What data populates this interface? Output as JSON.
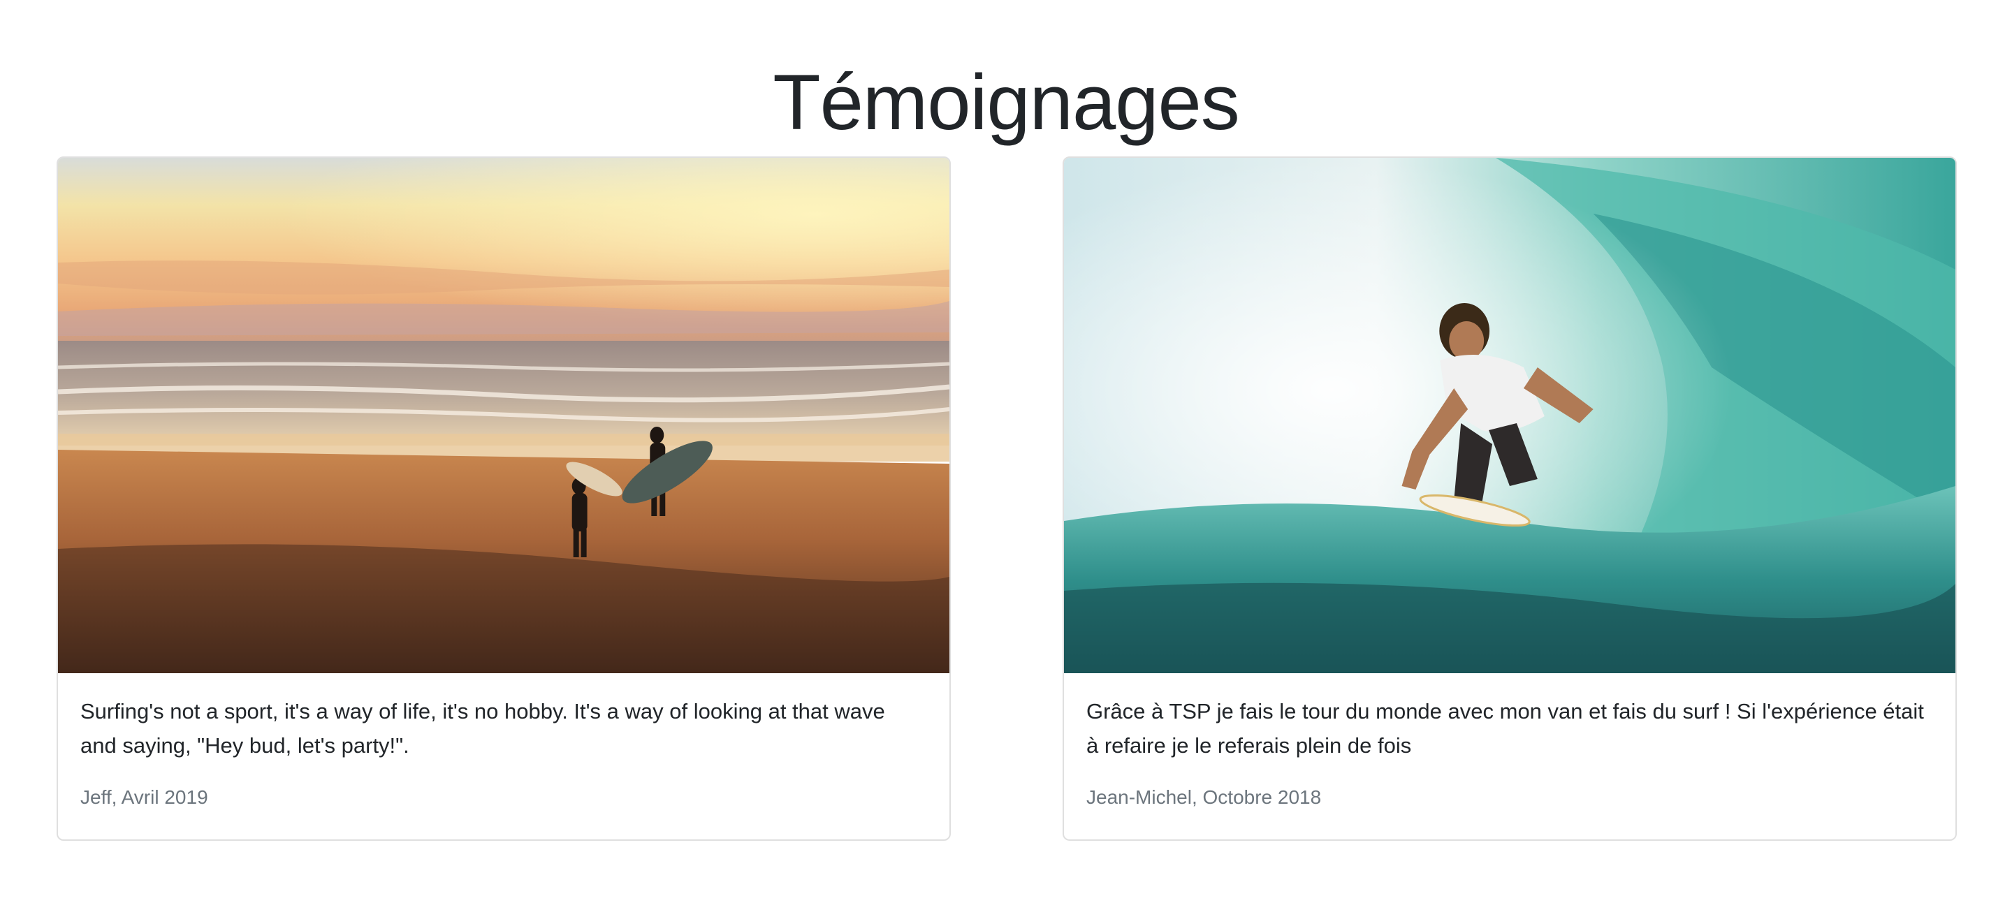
{
  "section": {
    "title": "Témoignages"
  },
  "testimonials": [
    {
      "image": "beach-sunset-surfers-photo",
      "quote": "Surfing's not a sport, it's a way of life, it's no hobby. It's a way of looking at that wave and saying, \"Hey bud, let's party!\".",
      "author": "Jeff, Avril 2019"
    },
    {
      "image": "surfer-in-wave-barrel-photo",
      "quote": "Grâce à TSP je fais le tour du monde avec mon van et fais du surf ! Si l'expérience était à refaire je le referais plein de fois",
      "author": "Jean-Michel, Octobre 2018"
    }
  ],
  "colors": {
    "text": "#212529",
    "muted": "#6c757d",
    "border": "#dfdfdf"
  }
}
